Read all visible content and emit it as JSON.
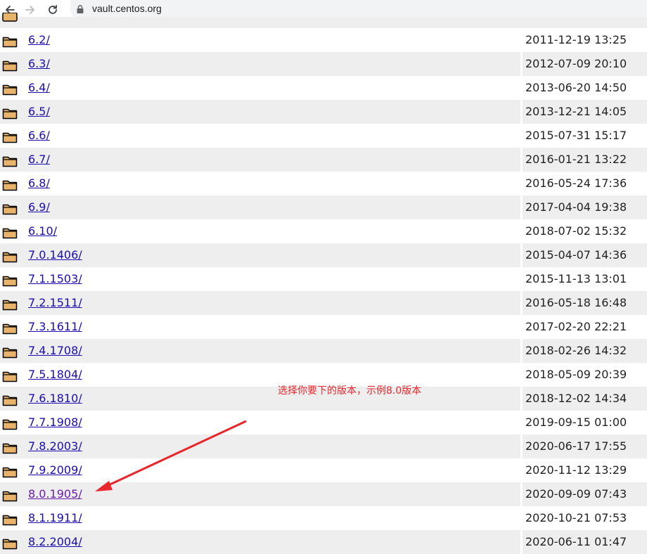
{
  "browser": {
    "url": "vault.centos.org",
    "back_icon": "arrow-left-icon",
    "forward_icon": "arrow-right-icon",
    "reload_icon": "reload-icon",
    "lock_icon": "lock-icon"
  },
  "colors": {
    "link": "#1a0dab",
    "visited_link": "#681da8",
    "row_shade": "#eeeeee",
    "annotation": "#e8262b",
    "folder_fill": "#e8b36a"
  },
  "rows": [
    {
      "name": "6.2/",
      "date": "2011-12-19 13:25"
    },
    {
      "name": "6.3/",
      "date": "2012-07-09 20:10"
    },
    {
      "name": "6.4/",
      "date": "2013-06-20 14:50"
    },
    {
      "name": "6.5/",
      "date": "2013-12-21 14:05"
    },
    {
      "name": "6.6/",
      "date": "2015-07-31 15:17"
    },
    {
      "name": "6.7/",
      "date": "2016-01-21 13:22"
    },
    {
      "name": "6.8/",
      "date": "2016-05-24 17:36"
    },
    {
      "name": "6.9/",
      "date": "2017-04-04 19:38"
    },
    {
      "name": "6.10/",
      "date": "2018-07-02 15:32"
    },
    {
      "name": "7.0.1406/",
      "date": "2015-04-07 14:36"
    },
    {
      "name": "7.1.1503/",
      "date": "2015-11-13 13:01"
    },
    {
      "name": "7.2.1511/",
      "date": "2016-05-18 16:48"
    },
    {
      "name": "7.3.1611/",
      "date": "2017-02-20 22:21"
    },
    {
      "name": "7.4.1708/",
      "date": "2018-02-26 14:32"
    },
    {
      "name": "7.5.1804/",
      "date": "2018-05-09 20:39"
    },
    {
      "name": "7.6.1810/",
      "date": "2018-12-02 14:34"
    },
    {
      "name": "7.7.1908/",
      "date": "2019-09-15 01:00"
    },
    {
      "name": "7.8.2003/",
      "date": "2020-06-17 17:55"
    },
    {
      "name": "7.9.2009/",
      "date": "2020-11-12 13:29"
    },
    {
      "name": "8.0.1905/",
      "date": "2020-09-09 07:43",
      "visited": true
    },
    {
      "name": "8.1.1911/",
      "date": "2020-10-21 07:53"
    },
    {
      "name": "8.2.2004/",
      "date": "2020-06-11 01:47"
    }
  ],
  "annotation": {
    "text": "选择你要下的版本，示例8.0版本"
  }
}
